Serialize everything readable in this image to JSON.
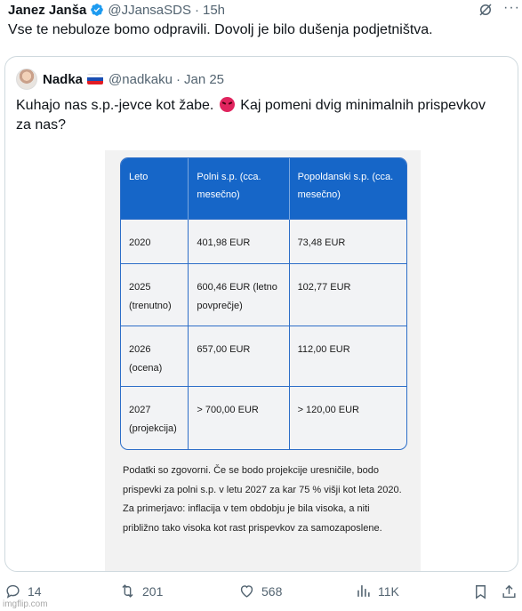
{
  "tweet": {
    "author": "Janez Janša",
    "handle": "@JJansaSDS",
    "separator": "·",
    "time": "15h",
    "more": "···",
    "text": "Vse te nebuloze bomo odpravili. Dovolj je bilo dušenja podjetništva."
  },
  "quote": {
    "author": "Nadka",
    "handle": "@nadkaku",
    "separator": "·",
    "time": "Jan 25",
    "text_before": "Kuhajo nas s.p.-jevce kot žabe.",
    "text_after": "Kaj pomeni dvig minimalnih prispevkov za nas?",
    "image": {
      "headers": [
        "Leto",
        "Polni s.p. (cca. mesečno)",
        "Popoldanski s.p. (cca. mesečno)"
      ],
      "rows": [
        [
          "2020",
          "401,98 EUR",
          "73,48 EUR"
        ],
        [
          "2025 (trenutno)",
          "600,46 EUR (letno povprečje)",
          "102,77 EUR"
        ],
        [
          "2026 (ocena)",
          "657,00 EUR",
          "112,00 EUR"
        ],
        [
          "2027 (projekcija)",
          "> 700,00 EUR",
          "> 120,00 EUR"
        ]
      ],
      "paragraph": "Podatki so zgovorni. Če se bodo projekcije uresničile, bodo prispevki za polni s.p. v letu 2027 za kar 75 % višji kot leta 2020. Za primerjavo: inflacija v tem obdobju je bila visoka, a niti približno tako visoka kot rast prispevkov za samozaposlene."
    }
  },
  "actions": {
    "replies": "14",
    "reposts": "201",
    "likes": "568",
    "views": "11K"
  },
  "watermark": "imgflip.com",
  "colors": {
    "verified": "#1d9bf0",
    "table_header": "#1666c8",
    "muted": "#536471"
  }
}
